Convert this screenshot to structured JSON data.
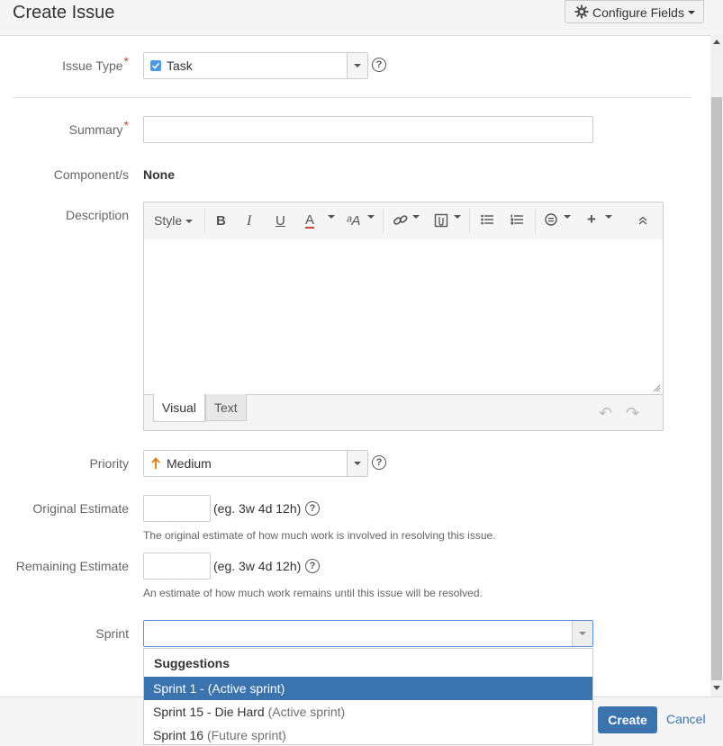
{
  "dialog": {
    "title": "Create Issue",
    "configure_fields_label": "Configure Fields"
  },
  "fields": {
    "issue_type": {
      "label": "Issue Type",
      "required_mark": "*",
      "value": "Task",
      "help": "?"
    },
    "summary": {
      "label": "Summary",
      "required_mark": "*",
      "value": ""
    },
    "components": {
      "label": "Component/s",
      "value": "None"
    },
    "description": {
      "label": "Description",
      "toolbar": {
        "style": "Style",
        "bold": "B",
        "italic": "I",
        "underline": "U",
        "text_color": "A",
        "text_effects": "ᵃA",
        "link": "🔗",
        "attachment": "⊞",
        "bullet_list": "☰",
        "numbered_list": "☰",
        "emoticon": "☺",
        "insert": "+",
        "collapse": "⌃"
      },
      "tabs": {
        "visual": "Visual",
        "text": "Text"
      },
      "undo": "↶",
      "redo": "↷"
    },
    "priority": {
      "label": "Priority",
      "value": "Medium",
      "icon_color": "#e07b00",
      "help": "?"
    },
    "original_estimate": {
      "label": "Original Estimate",
      "value": "",
      "hint": "(eg. 3w 4d 12h)",
      "help": "?",
      "description": "The original estimate of how much work is involved in resolving this issue."
    },
    "remaining_estimate": {
      "label": "Remaining Estimate",
      "value": "",
      "hint": "(eg. 3w 4d 12h)",
      "help": "?",
      "description": "An estimate of how much work remains until this issue will be resolved."
    },
    "sprint": {
      "label": "Sprint",
      "value": "",
      "dropdown": {
        "heading": "Suggestions",
        "items": [
          {
            "name": "Sprint 1 - (Active sprint)",
            "state": ""
          },
          {
            "name": "Sprint 15 - Die Hard",
            "state": "(Active sprint)"
          },
          {
            "name": "Sprint 16",
            "state": "(Future sprint)"
          }
        ]
      }
    }
  },
  "footer": {
    "create_label": "Create",
    "cancel_label": "Cancel"
  },
  "colors": {
    "primary": "#3b73af",
    "required": "#d04437",
    "checkbox": "#4a9ae1"
  }
}
